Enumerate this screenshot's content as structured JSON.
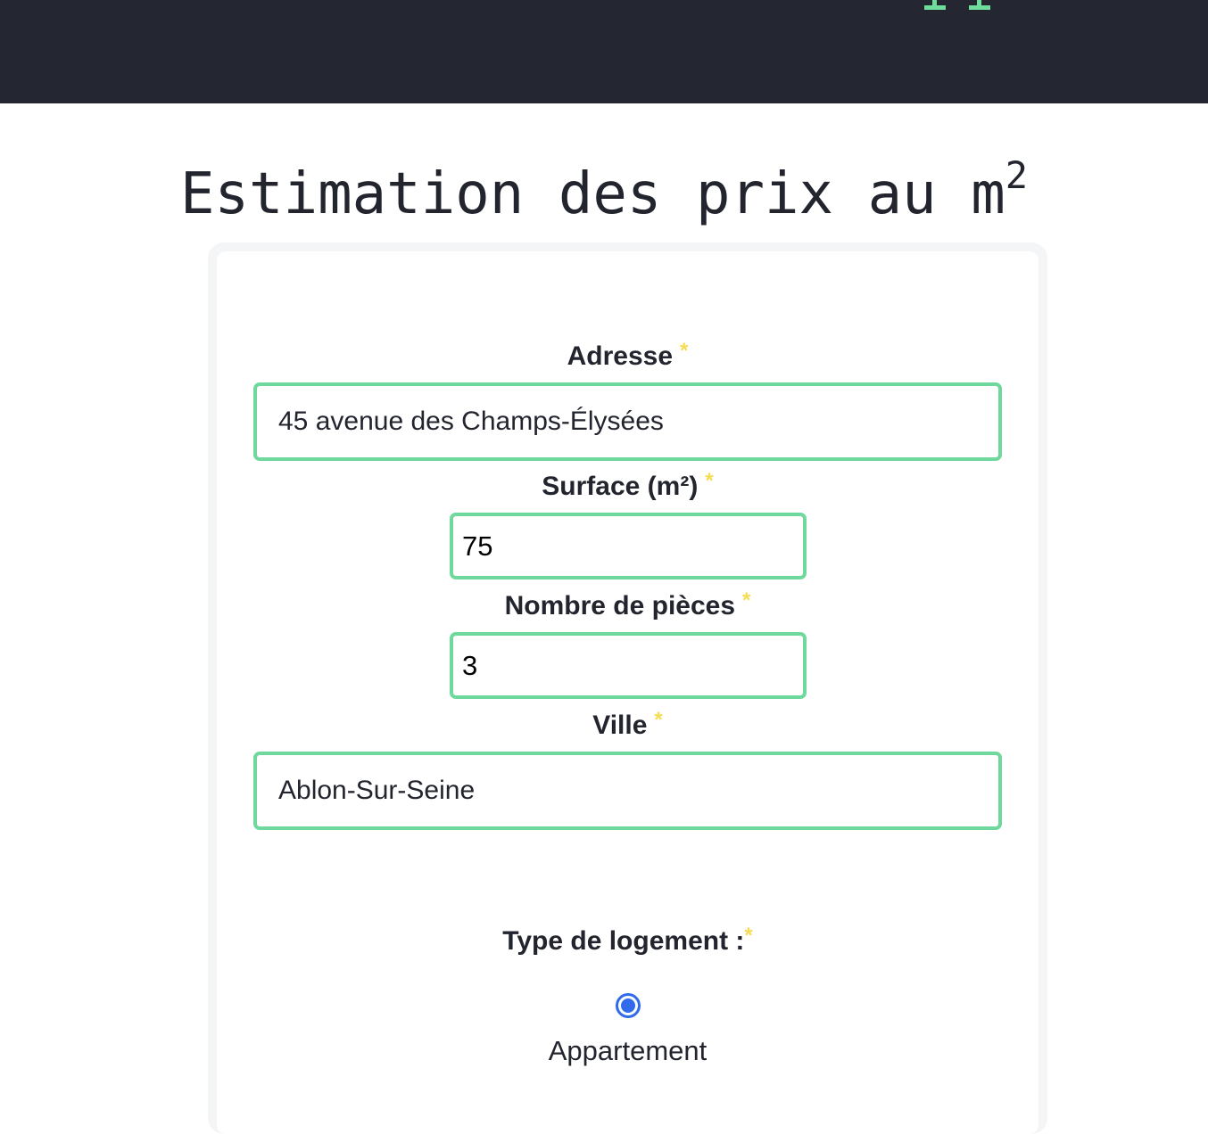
{
  "page": {
    "title": "Estimation des prix au m",
    "title_sup": "2"
  },
  "form": {
    "required_mark": "*",
    "address": {
      "label": "Adresse",
      "value": "45 avenue des Champs-Élysées"
    },
    "surface": {
      "label": "Surface (m²)",
      "value": "75"
    },
    "rooms": {
      "label": "Nombre de pièces",
      "value": "3"
    },
    "city": {
      "label": "Ville",
      "value": "Ablon-Sur-Seine"
    },
    "housing_type": {
      "label": "Type de logement :",
      "options": [
        {
          "label": "Appartement",
          "selected": true
        }
      ]
    }
  },
  "colors": {
    "topbar": "#242631",
    "accent": "#6fd89c",
    "required": "#f5dc55",
    "radio": "#2f6bea",
    "text": "#22242e"
  },
  "icons": {
    "logo": "brand-logo-icon"
  }
}
